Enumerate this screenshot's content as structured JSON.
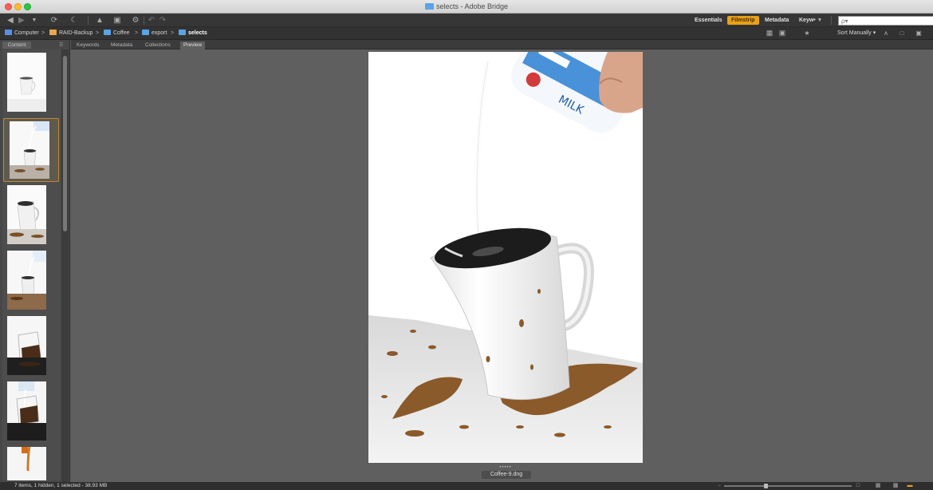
{
  "window": {
    "title": "selects - Adobe Bridge"
  },
  "toolbar": {
    "workspaces": [
      {
        "label": "Essentials",
        "active": false
      },
      {
        "label": "Filmstrip",
        "active": true
      },
      {
        "label": "Metadata",
        "active": false
      },
      {
        "label": "Keyw•",
        "active": false
      }
    ],
    "search": {
      "placeholder": "ρ▾",
      "value": ""
    }
  },
  "path": {
    "crumbs": [
      {
        "label": "Computer",
        "icon": "computer-icon"
      },
      {
        "label": "RAID-Backup",
        "icon": "drive-icon"
      },
      {
        "label": "Coffee",
        "icon": "folder-icon"
      },
      {
        "label": "export",
        "icon": "folder-icon"
      },
      {
        "label": "selects",
        "icon": "folder-icon"
      }
    ],
    "sort_label": "Sort Manually ▾"
  },
  "content_panel": {
    "tab_label": "Content"
  },
  "panel_tabs": [
    "Keywords",
    "Metadata",
    "Collections",
    "Preview"
  ],
  "preview": {
    "filename": "Coffee-9.dng",
    "rating_dots": "•••••"
  },
  "status": {
    "text": "7 items, 1 hidden, 1 selected - 38.93 MB"
  },
  "colors": {
    "accent": "#e8a117",
    "panel": "#474747",
    "preview_bg": "#5f5f5f",
    "coffee": "#8a5a2b"
  }
}
